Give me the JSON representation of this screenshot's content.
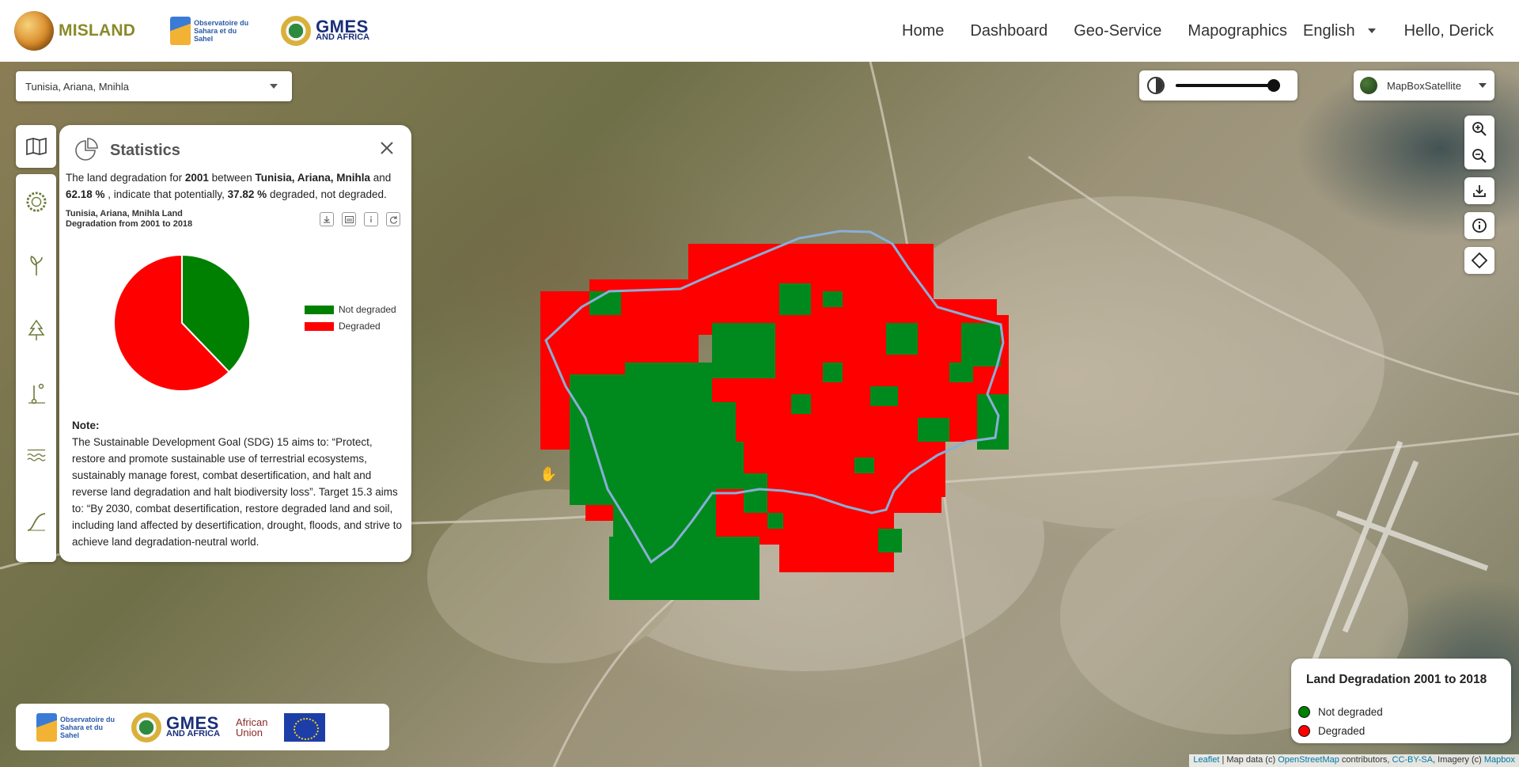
{
  "header": {
    "brand": "MISLAND",
    "partner_oss": "Observatoire du Sahara et du Sahel",
    "partner_gmes_big": "GMES",
    "partner_gmes_small": "AND AFRICA",
    "nav": [
      "Home",
      "Dashboard",
      "Geo-Service",
      "Mapographics"
    ],
    "language": "English",
    "user": "Hello, Derick"
  },
  "region_select": {
    "value": "Tunisia, Ariana, Mnihla"
  },
  "opacity_slider": {
    "value_percent": 100
  },
  "basemap_select": {
    "value": "MapBoxSatellite"
  },
  "icons": {
    "opacity": "contrast-icon",
    "zoom_in": "zoom-in-icon",
    "zoom_out": "zoom-out-icon",
    "download": "download-icon",
    "info": "info-icon",
    "draw": "polygon-draw-icon",
    "sidebar": [
      "map-icon",
      "sun-icon",
      "sprout-icon",
      "tree-icon",
      "temperature-icon",
      "water-level-icon",
      "curve-icon"
    ],
    "stats": "pie-chart-icon",
    "close": "close-icon"
  },
  "stats": {
    "title": "Statistics",
    "sentence": {
      "p1": "The land degradation for ",
      "year": "2001",
      "p2": " between ",
      "region": "Tunisia, Ariana, Mnihla",
      "p3": " and ",
      "pct_a": "62.18 %",
      "p4": " , indicate that potentially, ",
      "pct_b": "37.82 %",
      "p5": " degraded, not degraded."
    },
    "chart_title": "Tunisia, Ariana, Mnihla Land Degradation from 2001 to 2018",
    "note_label": "Note:",
    "note_text": "The Sustainable Development Goal (SDG) 15 aims to: “Protect, restore and promote sustainable use of terrestrial ecosystems, sustainably manage forest, combat desertification, and halt and reverse land degradation and halt biodiversity loss”. Target 15.3 aims to: “By 2030, combat desertification, restore degraded land and soil, including land affected by desertification, drought, floods, and strive to achieve land degradation-neutral world."
  },
  "chart_data": {
    "type": "pie",
    "title": "Tunisia, Ariana, Mnihla Land Degradation from 2001 to 2018",
    "categories": [
      "Not degraded",
      "Degraded"
    ],
    "values": [
      37.82,
      62.18
    ],
    "colors": [
      "#008000",
      "#ff0000"
    ],
    "legend": "right"
  },
  "footer": {
    "oss": "Observatoire du Sahara et du Sahel",
    "gmes_big": "GMES",
    "gmes_small": "AND AFRICA",
    "au_line1": "African",
    "au_line2": "Union"
  },
  "map_legend": {
    "title": "Land Degradation 2001 to 2018",
    "items": [
      {
        "label": "Not degraded",
        "color": "#008000"
      },
      {
        "label": "Degraded",
        "color": "#ff0000"
      }
    ]
  },
  "attribution": {
    "leaflet": "Leaflet",
    "sep1": " | Map data (c) ",
    "osm": "OpenStreetMap",
    "sep2": " contributors, ",
    "cc": "CC-BY-SA",
    "sep3": ", Imagery (c) ",
    "mapbox": "Mapbox"
  }
}
